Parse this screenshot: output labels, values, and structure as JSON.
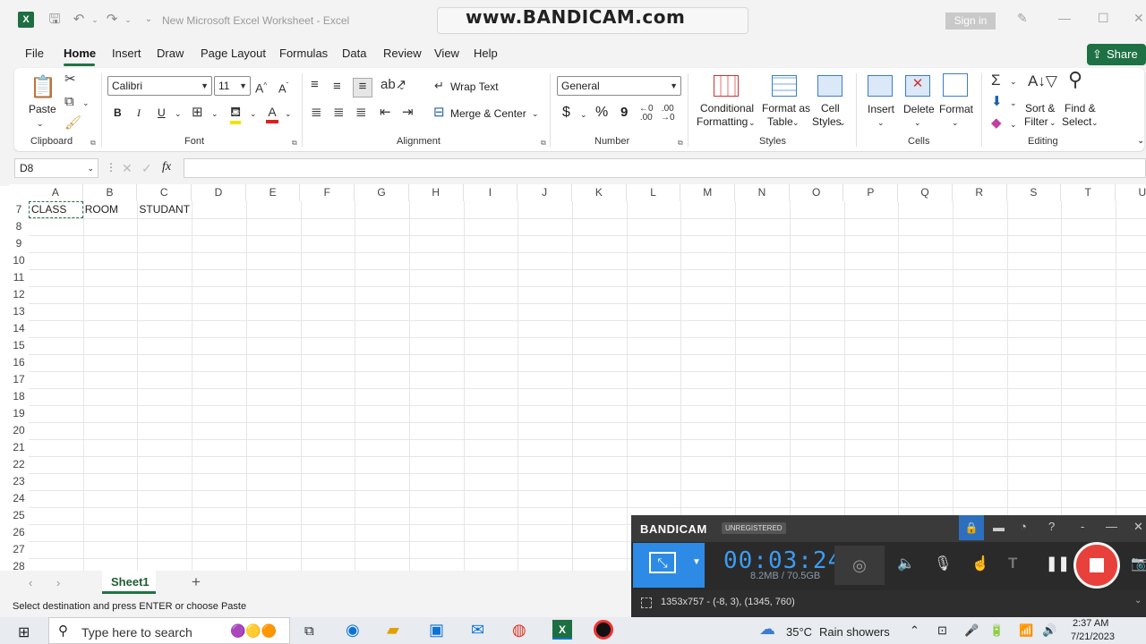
{
  "titlebar": {
    "doc_title": "New Microsoft Excel Worksheet  -  Excel",
    "watermark": "www.BANDICAM.com",
    "signin": "Sign in"
  },
  "menu_tabs": [
    "File",
    "Home",
    "Insert",
    "Draw",
    "Page Layout",
    "Formulas",
    "Data",
    "Review",
    "View",
    "Help"
  ],
  "share_label": "Share",
  "ribbon": {
    "clipboard": {
      "paste": "Paste",
      "group": "Clipboard"
    },
    "font": {
      "name": "Calibri",
      "size": "11",
      "bold": "B",
      "italic": "I",
      "underline": "U",
      "group": "Font"
    },
    "alignment": {
      "wrap": "Wrap Text",
      "merge": "Merge & Center",
      "group": "Alignment"
    },
    "number": {
      "format": "General",
      "currency": "$",
      "percent": "%",
      "comma": "9",
      "group": "Number"
    },
    "styles": {
      "cond1": "Conditional",
      "cond2": "Formatting",
      "fmt1": "Format as",
      "fmt2": "Table",
      "cell1": "Cell",
      "cell2": "Styles",
      "group": "Styles"
    },
    "cells": {
      "insert": "Insert",
      "delete": "Delete",
      "format": "Format",
      "group": "Cells"
    },
    "editing": {
      "sort1": "Sort &",
      "sort2": "Filter",
      "find1": "Find &",
      "find2": "Select",
      "group": "Editing"
    }
  },
  "formula_bar": {
    "name_box": "D8",
    "fx": "fx",
    "formula": ""
  },
  "grid": {
    "columns": [
      "A",
      "B",
      "C",
      "D",
      "E",
      "F",
      "G",
      "H",
      "I",
      "J",
      "K",
      "L",
      "M",
      "N",
      "O",
      "P",
      "Q",
      "R",
      "S",
      "T",
      "U"
    ],
    "rows": [
      "7",
      "8",
      "9",
      "10",
      "11",
      "12",
      "13",
      "14",
      "15",
      "16",
      "17",
      "18",
      "19",
      "20",
      "21",
      "22",
      "23",
      "24",
      "25",
      "26",
      "27",
      "28"
    ],
    "cells": {
      "A7": "CLASS",
      "B7": "ROOM",
      "C7": "STUDANT"
    }
  },
  "sheet_tab": "Sheet1",
  "status_text": "Select destination and press ENTER or choose Paste",
  "bandicam": {
    "brand": "BANDICAM",
    "unregistered": "UNREGISTERED",
    "timer": "00:03:24",
    "size": "8.2MB / 70.5GB",
    "region": "1353x757 - (-8, 3), (1345, 760)"
  },
  "taskbar": {
    "search_placeholder": "Type here to search",
    "weather": "35°C",
    "weather_text": "Rain showers",
    "time": "2:37 AM",
    "date": "7/21/2023"
  },
  "colors": {
    "excel_green": "#217346",
    "bandicam_blue": "#2d8be5",
    "stop_red": "#e8403a"
  }
}
